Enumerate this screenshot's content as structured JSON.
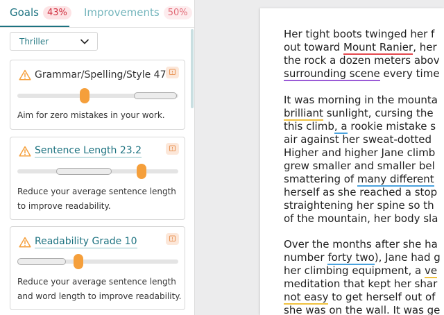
{
  "tabs": {
    "goals_label": "Goals",
    "goals_badge": "43%",
    "improvements_label": "Improvements",
    "improvements_badge": "50%"
  },
  "genre": {
    "selected": "Thriller"
  },
  "goals": [
    {
      "title": "Grammar/Spelling/Style 47%",
      "description": "Aim for zero mistakes in your work.",
      "level": 0.42
    },
    {
      "title": "Sentence Length 23.2",
      "description": "Reduce your average sentence length to improve readability.",
      "level": 0.77
    },
    {
      "title": "Readability Grade 10",
      "description": "Reduce your average sentence length and word length to improve readability.",
      "level": 0.38
    }
  ],
  "document": {
    "paragraph_1": [
      [
        {
          "t": "Her tight boots twinged her f"
        }
      ],
      [
        {
          "t": "out toward "
        },
        {
          "t": "Mount Ranier",
          "u": "red"
        },
        {
          "t": ", her"
        }
      ],
      [
        {
          "t": "the rock a dozen meters abov"
        }
      ],
      [
        {
          "t": "surrounding scene",
          "u": "purple"
        },
        {
          "t": " every time"
        }
      ]
    ],
    "paragraph_2": [
      [
        {
          "t": "It was morning in the mounta"
        }
      ],
      [
        {
          "t": "brilliant",
          "u": "yellow"
        },
        {
          "t": " sunlight, cursing the"
        }
      ],
      [
        {
          "t": "this climb"
        },
        {
          "t": ", a",
          "u": "blue"
        },
        {
          "t": " rookie mistake s"
        }
      ],
      [
        {
          "t": "air against her sweat-dotted"
        }
      ],
      [
        {
          "t": "Higher and higher Jane climb"
        }
      ],
      [
        {
          "t": "grew smaller and smaller bel"
        }
      ],
      [
        {
          "t": "smattering of "
        },
        {
          "t": "many different",
          "u": "blue"
        }
      ],
      [
        {
          "t": "herself as she reached a stop"
        }
      ],
      [
        {
          "t": "straightening her spine so th"
        }
      ],
      [
        {
          "t": "of the mountain, her body sla"
        }
      ]
    ],
    "paragraph_3": [
      [
        {
          "t": "Over the months after she ha"
        }
      ],
      [
        {
          "t": "number "
        },
        {
          "t": "forty two",
          "u": "blue"
        },
        {
          "t": "), Jane had g"
        }
      ],
      [
        {
          "t": "her climbing equipment, a "
        },
        {
          "t": "ve",
          "u": "yellow"
        }
      ],
      [
        {
          "t": "meditation that kept her shar"
        }
      ],
      [
        {
          "t": "not easy",
          "u": "yellow"
        },
        {
          "t": " to get herself out of"
        }
      ],
      [
        {
          "t": "she was on the wall. It was ge"
        }
      ]
    ]
  },
  "colors": {
    "accent": "#1c7280",
    "error_badge": "#cf2e3e",
    "slider_thumb": "#f59f3b",
    "warning_icon": "#f59f3b"
  }
}
